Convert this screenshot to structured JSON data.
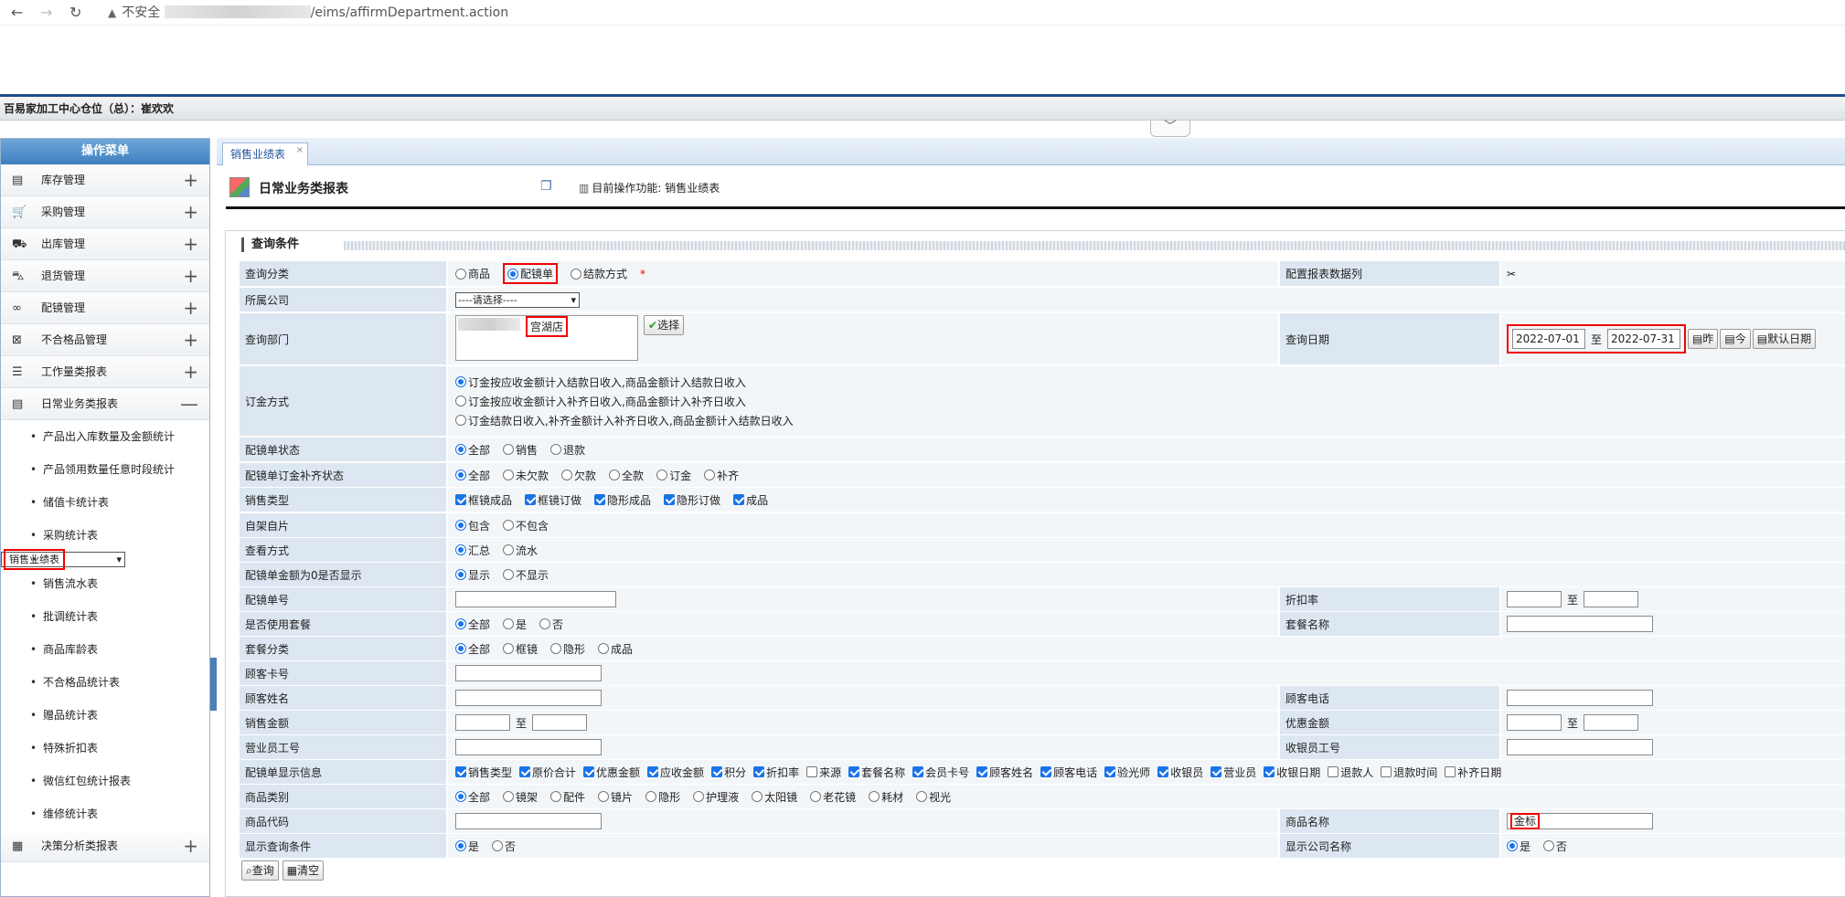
{
  "browser": {
    "back_icon": "←",
    "forward_icon": "→",
    "reload_icon": "↻",
    "security_label": "不安全",
    "url_path": "/eims/affirmDepartment.action"
  },
  "userbar": {
    "text": "百易家加工中心仓位（总）：崔欢欢"
  },
  "collapse_icon": "chevron-down",
  "sidebar": {
    "title": "操作菜单",
    "modules": [
      {
        "label": "库存管理",
        "icon": "inventory-icon",
        "glyph": "▤",
        "toggle": "+"
      },
      {
        "label": "采购管理",
        "icon": "cart-icon",
        "glyph": "🛒",
        "toggle": "+"
      },
      {
        "label": "出库管理",
        "icon": "outbound-icon",
        "glyph": "⛟",
        "toggle": "+"
      },
      {
        "label": "退货管理",
        "icon": "return-cart-icon",
        "glyph": "⛍",
        "toggle": "+"
      },
      {
        "label": "配镜管理",
        "icon": "glasses-icon",
        "glyph": "∞",
        "toggle": "+"
      },
      {
        "label": "不合格品管理",
        "icon": "reject-box-icon",
        "glyph": "⊠",
        "toggle": "+"
      },
      {
        "label": "工作量类报表",
        "icon": "bars-icon",
        "glyph": "☰",
        "toggle": "+"
      },
      {
        "label": "日常业务类报表",
        "icon": "report-icon",
        "glyph": "▤",
        "toggle": "—"
      }
    ],
    "subitems": [
      "产品出入库数量及金额统计",
      "产品领用数量任意时段统计",
      "储值卡统计表",
      "采购统计表",
      "销售业绩表",
      "销售流水表",
      "批调统计表",
      "商品库龄表",
      "不合格品统计表",
      "赠品统计表",
      "特殊折扣表",
      "微信红包统计报表",
      "维修统计表"
    ],
    "selected_subitem": "销售业绩表",
    "last_module": {
      "label": "决策分析类报表",
      "icon": "analysis-icon",
      "glyph": "▦",
      "toggle": "+"
    }
  },
  "tab": {
    "label": "销售业绩表",
    "close": "×"
  },
  "header": {
    "title": "日常业务类报表",
    "copy_icon": "copy-icon",
    "op_label": "目前操作功能: 销售业绩表"
  },
  "query": {
    "title": "查询条件",
    "r1": {
      "label": "查询分类",
      "opts": [
        "商品",
        "配镜单",
        "结款方式"
      ],
      "selected": "配镜单",
      "required": "*",
      "right_label": "配置报表数据列",
      "right_icon": "tools-icon"
    },
    "r2": {
      "label": "所属公司",
      "select": "----请选择----"
    },
    "r3": {
      "label": "查询部门",
      "dept": "宫湖店",
      "btn": "选择",
      "right_label": "查询日期",
      "date_from": "2022-07-01",
      "to": "至",
      "date_to": "2022-07-31",
      "btn_yesterday": "昨",
      "btn_today": "今",
      "btn_default": "默认日期"
    },
    "r4": {
      "label": "订金方式",
      "opts": [
        "订金按应收金额计入结款日收入,商品金额计入结款日收入",
        "订金按应收金额计入补齐日收入,商品金额计入补齐日收入",
        "订金结款日收入,补齐金额计入补齐日收入,商品金额计入结款日收入"
      ]
    },
    "r5": {
      "label": "配镜单状态",
      "opts": [
        "全部",
        "销售",
        "退款"
      ]
    },
    "r6": {
      "label": "配镜单订金补齐状态",
      "opts": [
        "全部",
        "未欠款",
        "欠款",
        "全款",
        "订金",
        "补齐"
      ]
    },
    "r7": {
      "label": "销售类型",
      "opts": [
        "框镜成品",
        "框镜订做",
        "隐形成品",
        "隐形订做",
        "成品"
      ]
    },
    "r8": {
      "label": "自架自片",
      "opts": [
        "包含",
        "不包含"
      ]
    },
    "r9": {
      "label": "查看方式",
      "opts": [
        "汇总",
        "流水"
      ]
    },
    "r10": {
      "label": "配镜单金额为0是否显示",
      "opts": [
        "显示",
        "不显示"
      ]
    },
    "r11": {
      "label": "配镜单号",
      "right_label": "折扣率",
      "to": "至"
    },
    "r12": {
      "label": "是否使用套餐",
      "opts": [
        "全部",
        "是",
        "否"
      ],
      "right_label": "套餐名称"
    },
    "r13": {
      "label": "套餐分类",
      "opts": [
        "全部",
        "框镜",
        "隐形",
        "成品"
      ]
    },
    "r14": {
      "label": "顾客卡号"
    },
    "r15": {
      "label": "顾客姓名",
      "right_label": "顾客电话"
    },
    "r16": {
      "label": "销售金额",
      "to": "至",
      "right_label": "优惠金额"
    },
    "r17": {
      "label": "营业员工号",
      "right_label": "收银员工号"
    },
    "r18": {
      "label": "配镜单显示信息",
      "opts": [
        {
          "t": "销售类型",
          "c": true
        },
        {
          "t": "原价合计",
          "c": true
        },
        {
          "t": "优惠金额",
          "c": true
        },
        {
          "t": "应收金额",
          "c": true
        },
        {
          "t": "积分",
          "c": true
        },
        {
          "t": "折扣率",
          "c": true
        },
        {
          "t": "来源",
          "c": false
        },
        {
          "t": "套餐名称",
          "c": true
        },
        {
          "t": "会员卡号",
          "c": true
        },
        {
          "t": "顾客姓名",
          "c": true
        },
        {
          "t": "顾客电话",
          "c": true
        },
        {
          "t": "验光师",
          "c": true
        },
        {
          "t": "收银员",
          "c": true
        },
        {
          "t": "营业员",
          "c": true
        },
        {
          "t": "收银日期",
          "c": true
        },
        {
          "t": "退款人",
          "c": false
        },
        {
          "t": "退款时间",
          "c": false
        },
        {
          "t": "补齐日期",
          "c": false
        }
      ]
    },
    "r19": {
      "label": "商品类别",
      "opts": [
        "全部",
        "镜架",
        "配件",
        "镜片",
        "隐形",
        "护理液",
        "太阳镜",
        "老花镜",
        "耗材",
        "视光"
      ]
    },
    "r20": {
      "label": "商品代码",
      "right_label": "商品名称",
      "right_value": "金标"
    },
    "r21": {
      "label": "显示查询条件",
      "opts": [
        "是",
        "否"
      ],
      "right_label": "显示公司名称"
    },
    "buttons": {
      "query": "查询",
      "clear": "清空"
    }
  }
}
